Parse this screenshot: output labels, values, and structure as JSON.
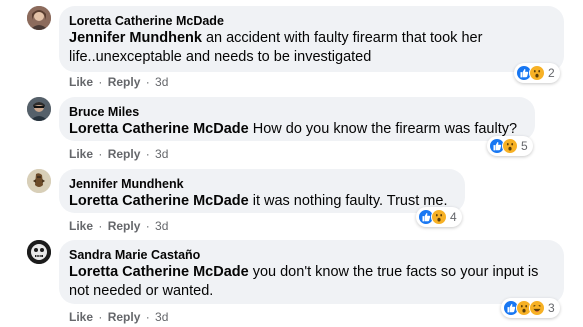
{
  "comments": [
    {
      "author": "Loretta Catherine McDade",
      "mention": "Jennifer Mundhenk",
      "text": " an accident with faulty firearm that took her life..unexceptable and needs to be investigated",
      "like": "Like",
      "reply": "Reply",
      "time": "3d",
      "reaction_count": "2",
      "reactions": [
        "like-reaction-icon",
        "wow-reaction-icon"
      ]
    },
    {
      "author": "Bruce Miles",
      "mention": "Loretta Catherine McDade",
      "text": " How do you know the firearm was faulty?",
      "like": "Like",
      "reply": "Reply",
      "time": "3d",
      "reaction_count": "5",
      "reactions": [
        "like-reaction-icon",
        "wow-reaction-icon"
      ]
    },
    {
      "author": "Jennifer Mundhenk",
      "mention": "Loretta Catherine McDade",
      "text": " it was nothing faulty. Trust me.",
      "like": "Like",
      "reply": "Reply",
      "time": "3d",
      "reaction_count": "4",
      "reactions": [
        "like-reaction-icon",
        "wow-reaction-icon"
      ]
    },
    {
      "author": "Sandra Marie Castaño",
      "mention": "Loretta Catherine McDade",
      "text": " you don't know the true facts so your input is not needed or wanted.",
      "like": "Like",
      "reply": "Reply",
      "time": "3d",
      "reaction_count": "3",
      "reactions": [
        "like-reaction-icon",
        "wow-reaction-icon",
        "haha-reaction-icon"
      ]
    }
  ],
  "colors": {
    "bubble": "#f0f2f5",
    "meta_text": "#65676b",
    "like_blue": "#1877f2",
    "wow_yellow": "#f7b125"
  }
}
